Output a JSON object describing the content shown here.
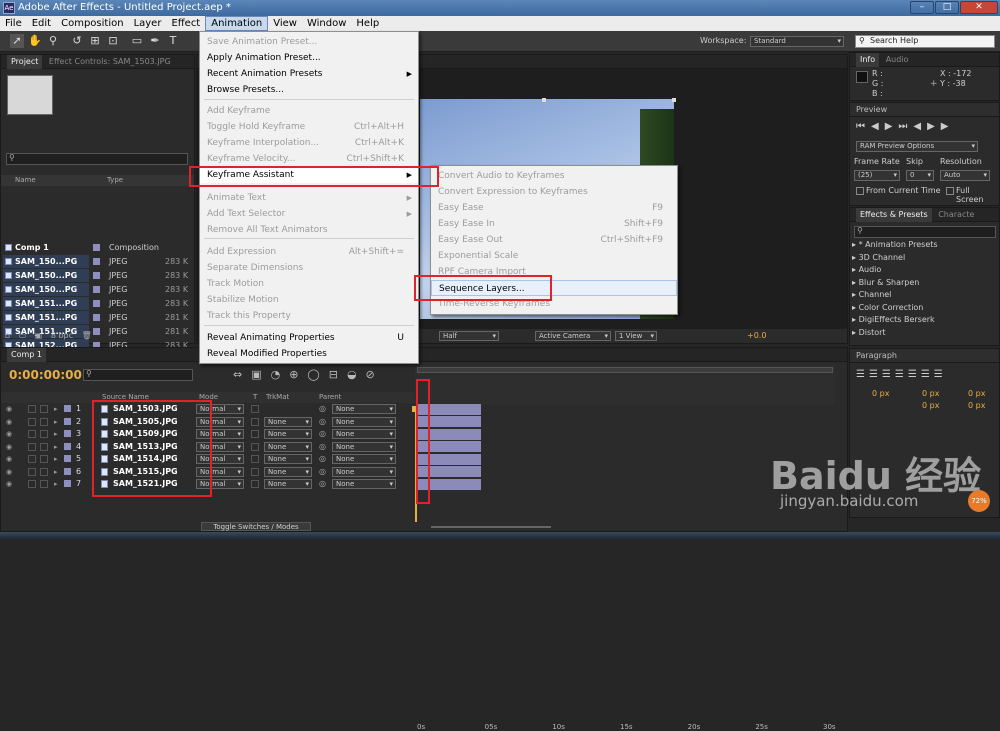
{
  "window": {
    "title": "Adobe After Effects - Untitled Project.aep *",
    "icon_label": "Ae"
  },
  "menubar": [
    "File",
    "Edit",
    "Composition",
    "Layer",
    "Effect",
    "Animation",
    "View",
    "Window",
    "Help"
  ],
  "toolbar": {
    "workspace_label": "Workspace:",
    "workspace_value": "Standard",
    "search_placeholder": "Search Help"
  },
  "project_panel": {
    "tabs": [
      "Project",
      "Effect Controls: SAM_1503.JPG"
    ],
    "columns": {
      "name": "Name",
      "type": "Type"
    },
    "rows": [
      {
        "name": "Comp 1",
        "type": "Composition",
        "size": ""
      },
      {
        "name": "SAM_150...PG",
        "type": "JPEG",
        "size": "283 K"
      },
      {
        "name": "SAM_150...PG",
        "type": "JPEG",
        "size": "283 K"
      },
      {
        "name": "SAM_150...PG",
        "type": "JPEG",
        "size": "283 K"
      },
      {
        "name": "SAM_151...PG",
        "type": "JPEG",
        "size": "283 K"
      },
      {
        "name": "SAM_151...PG",
        "type": "JPEG",
        "size": "281 K"
      },
      {
        "name": "SAM_151...PG",
        "type": "JPEG",
        "size": "281 K"
      },
      {
        "name": "SAM_152...PG",
        "type": "JPEG",
        "size": "283 K"
      }
    ],
    "bpc": "8 bpc"
  },
  "animation_menu": [
    {
      "label": "Save Animation Preset...",
      "shortcut": "",
      "disabled": true,
      "arrow": false
    },
    {
      "label": "Apply Animation Preset...",
      "shortcut": "",
      "disabled": false,
      "arrow": false
    },
    {
      "label": "Recent Animation Presets",
      "shortcut": "",
      "disabled": false,
      "arrow": true
    },
    {
      "label": "Browse Presets...",
      "shortcut": "",
      "disabled": false,
      "arrow": false
    },
    {
      "label": "Add Keyframe",
      "shortcut": "",
      "disabled": true,
      "arrow": false
    },
    {
      "label": "Toggle Hold Keyframe",
      "shortcut": "Ctrl+Alt+H",
      "disabled": true,
      "arrow": false
    },
    {
      "label": "Keyframe Interpolation...",
      "shortcut": "Ctrl+Alt+K",
      "disabled": true,
      "arrow": false
    },
    {
      "label": "Keyframe Velocity...",
      "shortcut": "Ctrl+Shift+K",
      "disabled": true,
      "arrow": false
    },
    {
      "label": "Keyframe Assistant",
      "shortcut": "",
      "disabled": false,
      "arrow": true
    },
    {
      "label": "Animate Text",
      "shortcut": "",
      "disabled": true,
      "arrow": true
    },
    {
      "label": "Add Text Selector",
      "shortcut": "",
      "disabled": true,
      "arrow": true
    },
    {
      "label": "Remove All Text Animators",
      "shortcut": "",
      "disabled": true,
      "arrow": false
    },
    {
      "label": "Add Expression",
      "shortcut": "Alt+Shift+=",
      "disabled": true,
      "arrow": false
    },
    {
      "label": "Separate Dimensions",
      "shortcut": "",
      "disabled": true,
      "arrow": false
    },
    {
      "label": "Track Motion",
      "shortcut": "",
      "disabled": true,
      "arrow": false
    },
    {
      "label": "Stabilize Motion",
      "shortcut": "",
      "disabled": true,
      "arrow": false
    },
    {
      "label": "Track this Property",
      "shortcut": "",
      "disabled": true,
      "arrow": false
    },
    {
      "label": "Reveal Animating Properties",
      "shortcut": "U",
      "disabled": false,
      "arrow": false
    },
    {
      "label": "Reveal Modified Properties",
      "shortcut": "",
      "disabled": false,
      "arrow": false
    }
  ],
  "keyframe_assistant_submenu": [
    {
      "label": "Convert Audio to Keyframes",
      "shortcut": "",
      "disabled": true
    },
    {
      "label": "Convert Expression to Keyframes",
      "shortcut": "",
      "disabled": true
    },
    {
      "label": "Easy Ease",
      "shortcut": "F9",
      "disabled": true
    },
    {
      "label": "Easy Ease In",
      "shortcut": "Shift+F9",
      "disabled": true
    },
    {
      "label": "Easy Ease Out",
      "shortcut": "Ctrl+Shift+F9",
      "disabled": true
    },
    {
      "label": "Exponential Scale",
      "shortcut": "",
      "disabled": true
    },
    {
      "label": "RPF Camera Import",
      "shortcut": "",
      "disabled": true
    },
    {
      "label": "Sequence Layers...",
      "shortcut": "",
      "disabled": false
    },
    {
      "label": "Time-Reverse Keyframes",
      "shortcut": "",
      "disabled": true
    }
  ],
  "viewer_controls": {
    "resolution": "Half",
    "camera": "Active Camera",
    "views": "1 View",
    "exposure": "+0.0"
  },
  "info_panel": {
    "tabs": [
      "Info",
      "Audio"
    ],
    "r": "R :",
    "g": "G :",
    "b": "B :",
    "x": "X : -172",
    "y": "Y : -38"
  },
  "preview_panel": {
    "title": "Preview",
    "ram_options": "RAM Preview Options",
    "frame_rate_label": "Frame Rate",
    "skip_label": "Skip",
    "resolution_label": "Resolution",
    "frame_rate": "(25)",
    "skip": "0",
    "resolution": "Auto",
    "from_current": "From Current Time",
    "full_screen": "Full Screen"
  },
  "effects_panel": {
    "tabs": [
      "Effects & Presets",
      "Characte"
    ],
    "items": [
      "* Animation Presets",
      "3D Channel",
      "Audio",
      "Blur & Sharpen",
      "Channel",
      "Color Correction",
      "DigiEffects Berserk",
      "Distort"
    ]
  },
  "paragraph_panel": {
    "title": "Paragraph",
    "px": [
      "0 px",
      "0 px",
      "0 px",
      "0 px",
      "0 px"
    ]
  },
  "timeline": {
    "tab": "Comp 1",
    "timecode": "0:00:00:00",
    "columns": {
      "source": "Source Name",
      "mode": "Mode",
      "t": "T",
      "trkmat": "TrkMat",
      "parent": "Parent"
    },
    "ruler": [
      "0s",
      "05s",
      "10s",
      "15s",
      "20s",
      "25s",
      "30s"
    ],
    "layers": [
      {
        "num": "1",
        "name": "SAM_1503.JPG",
        "mode": "Normal",
        "trkmat": "",
        "parent": "None"
      },
      {
        "num": "2",
        "name": "SAM_1505.JPG",
        "mode": "Normal",
        "trkmat": "None",
        "parent": "None"
      },
      {
        "num": "3",
        "name": "SAM_1509.JPG",
        "mode": "Normal",
        "trkmat": "None",
        "parent": "None"
      },
      {
        "num": "4",
        "name": "SAM_1513.JPG",
        "mode": "Normal",
        "trkmat": "None",
        "parent": "None"
      },
      {
        "num": "5",
        "name": "SAM_1514.JPG",
        "mode": "Normal",
        "trkmat": "None",
        "parent": "None"
      },
      {
        "num": "6",
        "name": "SAM_1515.JPG",
        "mode": "Normal",
        "trkmat": "None",
        "parent": "None"
      },
      {
        "num": "7",
        "name": "SAM_1521.JPG",
        "mode": "Normal",
        "trkmat": "None",
        "parent": "None"
      }
    ],
    "toggle": "Toggle Switches / Modes"
  },
  "watermark": {
    "brand": "Baidu 经验",
    "url": "jingyan.baidu.com"
  },
  "tray": {
    "percent": "72%"
  },
  "colors": {
    "highlight": "#e0222a",
    "menu_bg": "#f1f1f1",
    "panel_bg": "#2b2b2b",
    "timecode": "#e8b040"
  }
}
